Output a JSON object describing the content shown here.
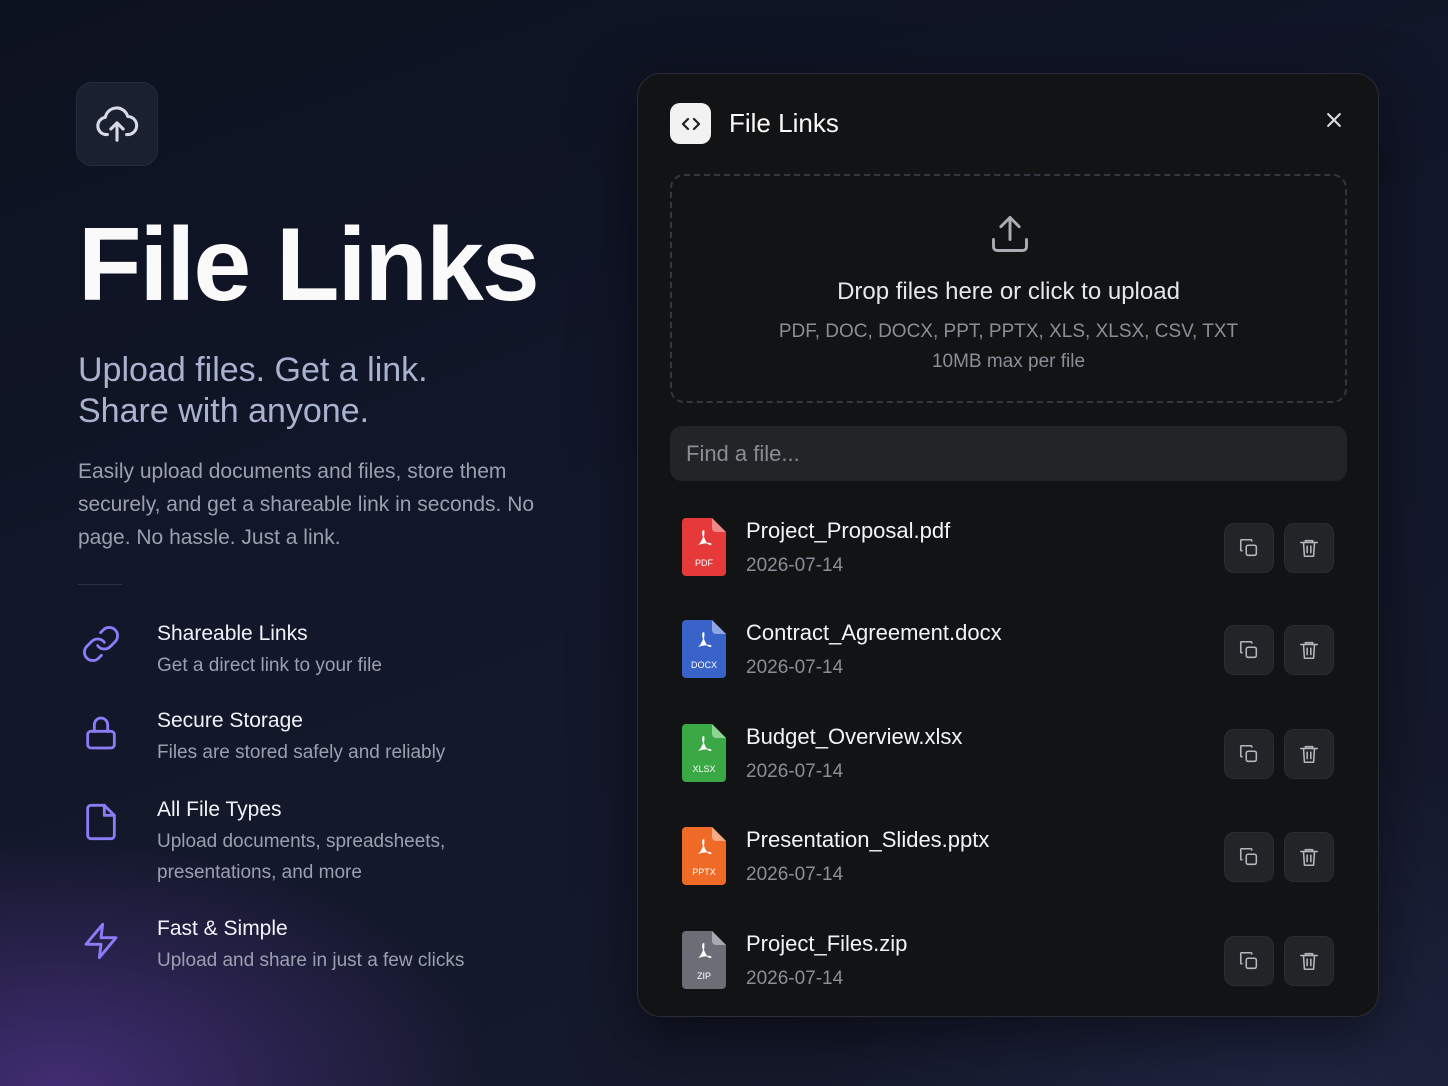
{
  "hero": {
    "title": "File Links",
    "tagline_line1": "Upload files. Get a link.",
    "tagline_line2": "Share with anyone.",
    "description": "Easily upload documents and files, store them securely, and get a shareable link in seconds. No page. No hassle. Just a link.",
    "logo_icon": "cloud-upload-icon"
  },
  "features": [
    {
      "icon": "link-icon",
      "title": "Shareable Links",
      "desc": "Get a direct link to your file"
    },
    {
      "icon": "lock-icon",
      "title": "Secure Storage",
      "desc": "Files are stored safely and reliably"
    },
    {
      "icon": "file-icon",
      "title": "All File Types",
      "desc": "Upload documents, spreadsheets, presentations, and more"
    },
    {
      "icon": "lightning-icon",
      "title": "Fast & Simple",
      "desc": "Upload and share in just a few clicks"
    }
  ],
  "panel": {
    "title": "File Links",
    "header_icon": "code-brackets-icon",
    "close_icon": "close-icon",
    "dropzone": {
      "main": "Drop files here or click to upload",
      "types": "PDF, DOC, DOCX, PPT, PPTX, XLS, XLSX, CSV, TXT",
      "max": "10MB max per file"
    },
    "search": {
      "placeholder": "Find a file...",
      "value": ""
    },
    "files": [
      {
        "name": "Project_Proposal.pdf",
        "date": "2026-07-14",
        "badge": "PDF",
        "color": "#e5393a"
      },
      {
        "name": "Contract_Agreement.docx",
        "date": "2026-07-14",
        "badge": "DOCX",
        "color": "#3a63c9"
      },
      {
        "name": "Budget_Overview.xlsx",
        "date": "2026-07-14",
        "badge": "XLSX",
        "color": "#3aa845"
      },
      {
        "name": "Presentation_Slides.pptx",
        "date": "2026-07-14",
        "badge": "PPTX",
        "color": "#ee6a26"
      },
      {
        "name": "Project_Files.zip",
        "date": "2026-07-14",
        "badge": "ZIP",
        "color": "#6b6e76"
      }
    ]
  },
  "colors": {
    "accent": "#7c6cf6",
    "panel_bg": "#121315",
    "page_bg": "#12172a"
  }
}
